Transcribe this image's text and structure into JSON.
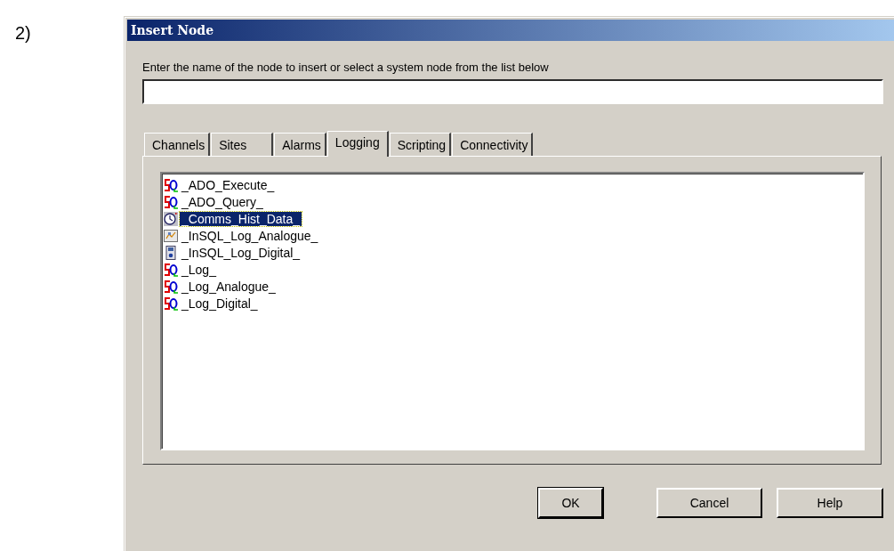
{
  "step_label": "2)",
  "window": {
    "title": "Insert Node"
  },
  "prompt": "Enter the name of the node to insert or select a system node from the list below",
  "tabs": [
    {
      "label": "Channels",
      "selected": false
    },
    {
      "label": "Sites",
      "selected": false
    },
    {
      "label": "Alarms",
      "selected": false
    },
    {
      "label": "Logging",
      "selected": true
    },
    {
      "label": "Scripting",
      "selected": false
    },
    {
      "label": "Connectivity",
      "selected": false
    }
  ],
  "nodes": [
    {
      "label": "_ADO_Execute_",
      "kind": "sql",
      "selected": false
    },
    {
      "label": "_ADO_Query_",
      "kind": "sql",
      "selected": false
    },
    {
      "label": "_Comms_Hist_Data_",
      "kind": "clock",
      "selected": true
    },
    {
      "label": "_InSQL_Log_Analogue_",
      "kind": "analogue",
      "selected": false
    },
    {
      "label": "_InSQL_Log_Digital_",
      "kind": "digital",
      "selected": false
    },
    {
      "label": "_Log_",
      "kind": "sql",
      "selected": false
    },
    {
      "label": "_Log_Analogue_",
      "kind": "sql",
      "selected": false
    },
    {
      "label": "_Log_Digital_",
      "kind": "sql",
      "selected": false
    }
  ],
  "buttons": [
    {
      "label": "OK",
      "default": true
    },
    {
      "label": "Cancel",
      "default": false
    },
    {
      "label": "Help",
      "default": false
    }
  ]
}
